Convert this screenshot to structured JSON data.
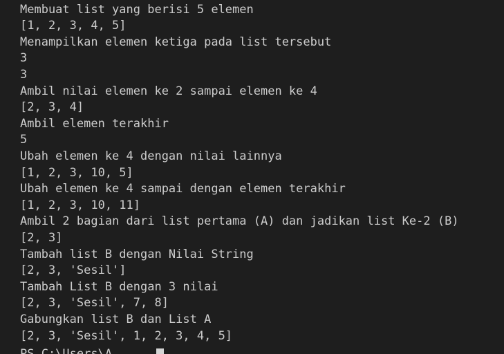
{
  "terminal": {
    "lines": [
      "Membuat list yang berisi 5 elemen",
      "[1, 2, 3, 4, 5]",
      "Menampilkan elemen ketiga pada list tersebut",
      "3",
      "3",
      "Ambil nilai elemen ke 2 sampai elemen ke 4",
      "[2, 3, 4]",
      "Ambil elemen terakhir",
      "5",
      "Ubah elemen ke 4 dengan nilai lainnya",
      "[1, 2, 3, 10, 5]",
      "Ubah elemen ke 4 sampai dengan elemen terakhir",
      "[1, 2, 3, 10, 11]",
      "Ambil 2 bagian dari list pertama (A) dan jadikan list Ke-2 (B)",
      "[2, 3]",
      "Tambah list B dengan Nilai String",
      "[2, 3, 'Sesil']",
      "Tambah List B dengan 3 nilai",
      "[2, 3, 'Sesil', 7, 8]",
      "Gabungkan list B dan List A",
      "[2, 3, 'Sesil', 1, 2, 3, 4, 5]"
    ],
    "prompt": "PS C:\\Users\\A"
  },
  "colors": {
    "background": "#1e1e1e",
    "text": "#cccccc",
    "cursor": "#d4d4d4"
  }
}
